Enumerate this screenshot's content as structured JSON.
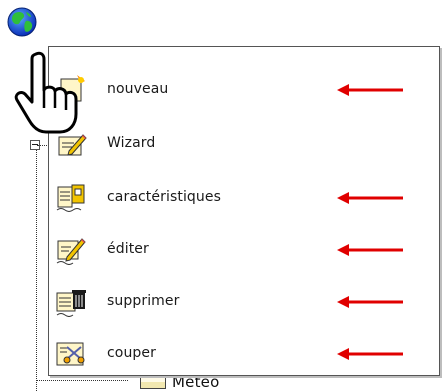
{
  "tree": {
    "node_label": "Meteo",
    "node_icon": "folder-table-icon",
    "root_icon": "globe-icon"
  },
  "cursor": {
    "icon": "hand-pointer-icon"
  },
  "menu": {
    "items": [
      {
        "label": "nouveau",
        "icon": "new-icon",
        "arrow": true
      },
      {
        "label": "Wizard",
        "icon": "wizard-pencil-icon",
        "arrow": false
      },
      {
        "label": "caractéristiques",
        "icon": "properties-icon",
        "arrow": true
      },
      {
        "label": "éditer",
        "icon": "edit-pencil-icon",
        "arrow": true
      },
      {
        "label": "supprimer",
        "icon": "delete-trash-icon",
        "arrow": true
      },
      {
        "label": "couper",
        "icon": "cut-scissors-icon",
        "arrow": true
      }
    ]
  },
  "colors": {
    "arrow": "#e00000",
    "icon_paper": "#fff6c8",
    "icon_yellow": "#f2c400"
  }
}
